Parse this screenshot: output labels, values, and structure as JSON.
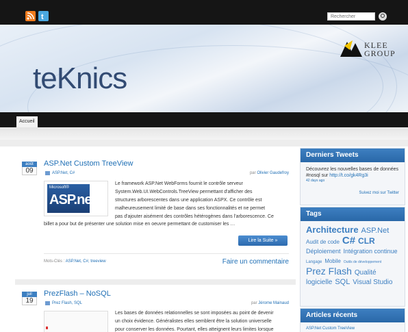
{
  "topbar": {
    "search_placeholder": "Rechercher",
    "icons": [
      "rss-icon",
      "twitter-icon",
      "search-icon"
    ]
  },
  "header": {
    "site_title": "teKnics",
    "logo_text_line1": "Klee",
    "logo_text_line2": "Group"
  },
  "nav": {
    "items": [
      {
        "label": "Accueil"
      }
    ]
  },
  "posts": [
    {
      "month": "août",
      "day": "09",
      "title": "ASP.Net Custom TreeView",
      "categories": "ASP.Net, C#",
      "author_prefix": "par",
      "author": "Olivier Gaudefroy",
      "image_alt": "Microsoft ASP.net",
      "image_top_label": "Microsoft®",
      "image_main_label": "ASP.net",
      "excerpt_lines": [
        "Le framework ASP.Net WebForms fournit le contrôle serveur",
        "System.Web.UI.WebControls.TreeView permettant d'afficher des",
        "structures arborescentes dans une application ASPX. Ce contrôle est",
        "malheureusement limité de base dans ses fonctionnalités et ne permet",
        "pas d'ajouter aisément des contrôles hétérogènes dans l'arborescence. Ce"
      ],
      "excerpt_last": "billet a pour but de présenter une solution mise en oeuvre permettant de customiser les …",
      "readmore": "Lire la Suite »",
      "tags_prefix": "Mots-Clés :",
      "tags": "ASP.Net, C#, treeview",
      "comment": "Faire un commentaire"
    },
    {
      "month": "juil",
      "day": "19",
      "title": "PrezFlash – NoSQL",
      "categories": "Prez Flash, SQL",
      "author_prefix": "par",
      "author": "Jérome Mainaud",
      "excerpt_lines": [
        "Les bases de données relationnelles se sont imposées au point de devenir",
        "un choix évidence. Généralistes elles semblent être la solution universelle",
        "pour conserver les données. Pourtant, elles atteignent leurs limites lorsque"
      ]
    }
  ],
  "sidebar": {
    "tweets_title": "Derniers Tweets",
    "tweet_text": "Découvrez les nouvelles bases de données #nosql sur",
    "tweet_link": "http://t.co/gk4Rg3i",
    "tweet_time": "42 days ago",
    "follow": "Suivez moi sur Twitter",
    "tags_title": "Tags",
    "tags": [
      {
        "label": "Architecture",
        "size": 13,
        "weight": "bold"
      },
      {
        "label": "ASP.Net",
        "size": 11,
        "weight": "normal"
      },
      {
        "label": "Audit de code",
        "size": 8,
        "weight": "normal"
      },
      {
        "label": "C#",
        "size": 15,
        "weight": "bold"
      },
      {
        "label": "CLR",
        "size": 12,
        "weight": "bold"
      },
      {
        "label": "Déploiement",
        "size": 9,
        "weight": "normal"
      },
      {
        "label": "Intégration continue",
        "size": 9,
        "weight": "normal"
      },
      {
        "label": "Langage",
        "size": 6,
        "weight": "normal"
      },
      {
        "label": "Mobile",
        "size": 8,
        "weight": "normal"
      },
      {
        "label": "Outils de développement",
        "size": 5,
        "weight": "normal"
      },
      {
        "label": "Prez Flash",
        "size": 14,
        "weight": "normal"
      },
      {
        "label": "Qualité logicielle",
        "size": 10,
        "weight": "normal"
      },
      {
        "label": "SQL",
        "size": 11,
        "weight": "normal"
      },
      {
        "label": "Visual Studio",
        "size": 10,
        "weight": "normal"
      }
    ],
    "recent_title": "Articles récents",
    "recent_items": [
      "ASP.Net Custom TreeView"
    ]
  },
  "colors": {
    "accent": "#3d7fc1",
    "link": "#1f6fb5",
    "topbar": "#151515"
  }
}
